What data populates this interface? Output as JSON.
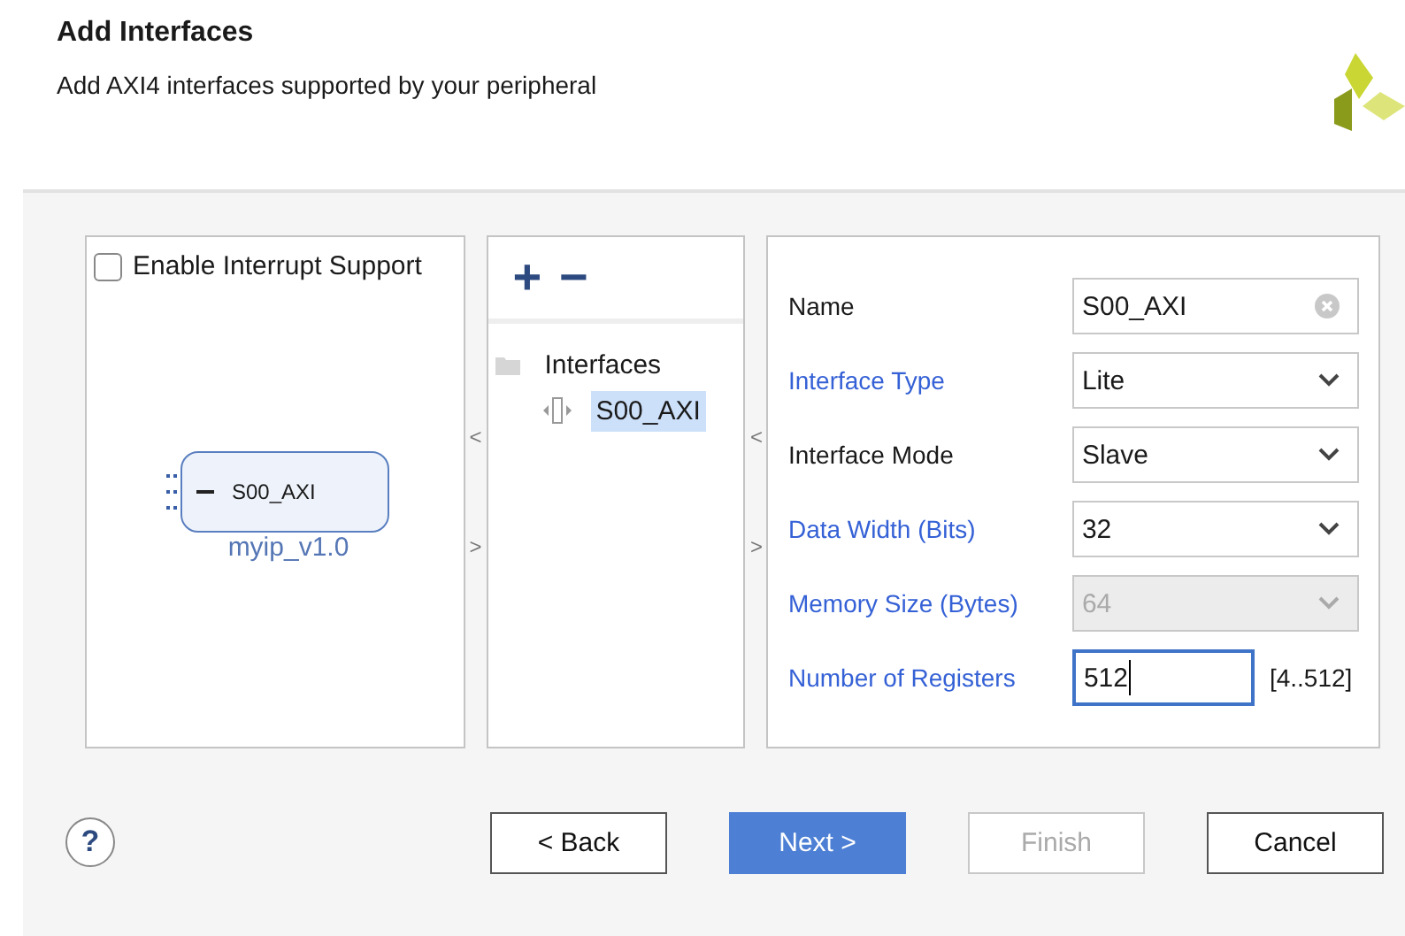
{
  "header": {
    "title": "Add Interfaces",
    "subtitle": "Add AXI4 interfaces supported by your peripheral"
  },
  "left_panel": {
    "checkbox": {
      "label": "Enable Interrupt Support",
      "checked": false
    },
    "block": {
      "port": "S00_AXI",
      "name": "myip_v1.0"
    }
  },
  "splitters": [
    "<",
    ">"
  ],
  "middle_panel": {
    "add": "+",
    "remove": "−",
    "tree": [
      {
        "label": "Interfaces",
        "selected": false,
        "children": [
          {
            "label": "S00_AXI",
            "selected": true
          }
        ]
      }
    ]
  },
  "splitters2": [
    "<",
    ">"
  ],
  "fields": [
    {
      "label": "Name",
      "linked": false,
      "kind": "text",
      "value": "S00_AXI",
      "disabled": false,
      "focused": false
    },
    {
      "label": "Interface Type",
      "linked": true,
      "kind": "select",
      "value": "Lite",
      "disabled": false,
      "focused": false
    },
    {
      "label": "Interface Mode",
      "linked": false,
      "kind": "select",
      "value": "Slave",
      "disabled": false,
      "focused": false
    },
    {
      "label": "Data Width (Bits)",
      "linked": true,
      "kind": "select",
      "value": "32",
      "disabled": false,
      "focused": false
    },
    {
      "label": "Memory Size (Bytes)",
      "linked": true,
      "kind": "select",
      "value": "64",
      "disabled": true,
      "focused": false
    },
    {
      "label": "Number of Registers",
      "linked": true,
      "kind": "number",
      "value": "512",
      "disabled": false,
      "focused": true,
      "range": "[4..512]"
    }
  ],
  "footer": {
    "help": "?",
    "buttons": [
      {
        "label": "< Back",
        "primary": false,
        "disabled": false
      },
      {
        "label": "Next >",
        "primary": true,
        "disabled": false
      },
      {
        "label": "Finish",
        "primary": false,
        "disabled": true
      },
      {
        "label": "Cancel",
        "primary": false,
        "disabled": false
      }
    ]
  }
}
